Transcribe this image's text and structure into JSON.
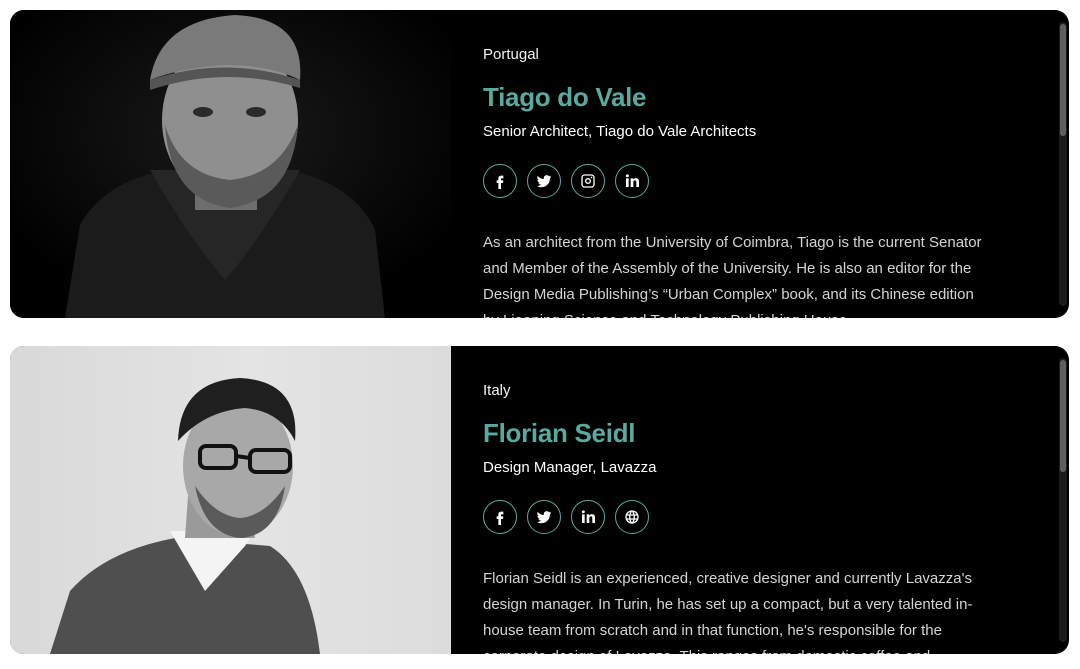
{
  "speakers": [
    {
      "country": "Portugal",
      "name": "Tiago do Vale",
      "role": "Senior Architect, Tiago do Vale Architects",
      "socials": [
        "facebook-icon",
        "twitter-icon",
        "instagram-icon",
        "linkedin-icon"
      ],
      "bio": "As an architect from the University of Coimbra, Tiago is the current Senator and Member of the Assembly of the University. He is also an editor for the Design Media Publishing’s “Urban Complex” book, and its Chinese edition by Liaoning Science and Technology Publishing House."
    },
    {
      "country": "Italy",
      "name": "Florian Seidl",
      "role": "Design Manager, Lavazza",
      "socials": [
        "facebook-icon",
        "twitter-icon",
        "linkedin-icon",
        "globe-icon"
      ],
      "bio": "Florian Seidl is an experienced, creative designer and currently Lavazza's design manager. In Turin, he has set up a compact, but a very talented in-house team from scratch and in that function, he's responsible for the corporate design of Lavazza. This ranges from domestic coffee and"
    }
  ],
  "colors": {
    "accent": "#5ba99e",
    "card_bg": "#000000",
    "text": "#ffffff"
  }
}
